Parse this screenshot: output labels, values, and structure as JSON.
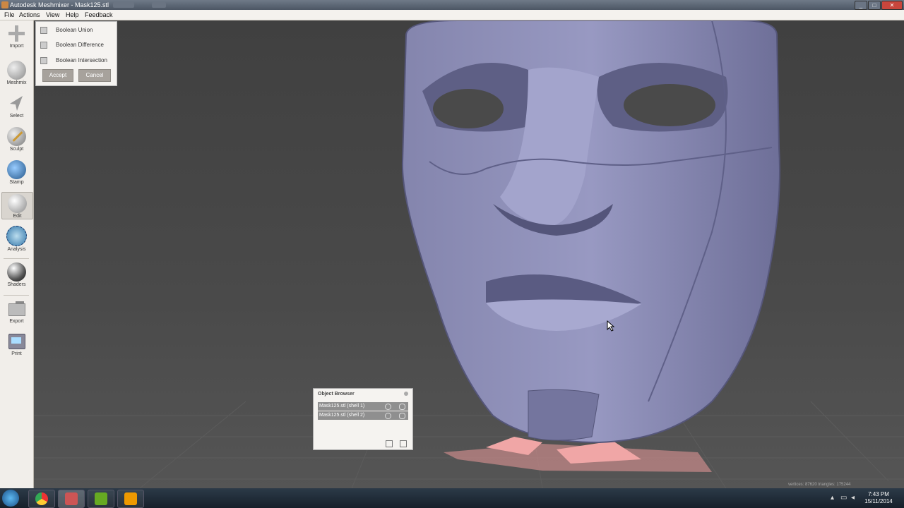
{
  "window": {
    "title": "Autodesk Meshmixer - Mask125.stl"
  },
  "menu": [
    "File",
    "Actions",
    "View",
    "Help",
    "Feedback"
  ],
  "tools": [
    {
      "label": "Import",
      "icon": "import-icon"
    },
    {
      "label": "Meshmix",
      "icon": "meshmix-icon"
    },
    {
      "label": "Select",
      "icon": "select-icon"
    },
    {
      "label": "Sculpt",
      "icon": "sculpt-icon"
    },
    {
      "label": "Stamp",
      "icon": "stamp-icon"
    },
    {
      "label": "Edit",
      "icon": "edit-icon"
    },
    {
      "label": "Analysis",
      "icon": "analysis-icon"
    },
    {
      "label": "Shaders",
      "icon": "shaders-icon"
    },
    {
      "label": "Export",
      "icon": "export-icon"
    },
    {
      "label": "Print",
      "icon": "print-icon"
    }
  ],
  "boolean_panel": {
    "options": [
      "Boolean Union",
      "Boolean Difference",
      "Boolean Intersection"
    ],
    "accept": "Accept",
    "cancel": "Cancel"
  },
  "object_browser": {
    "title": "Object Browser",
    "items": [
      "Mask125.stl (shell 1)",
      "Mask125.stl (shell 2)"
    ]
  },
  "stats": "vertices: 87620 triangles: 175244",
  "clock": {
    "time": "7:43 PM",
    "date": "15/11/2014"
  },
  "colors": {
    "mesh": "#7c7da6",
    "mesh_highlight": "#a9aad0",
    "support": "#f0a0a0"
  }
}
